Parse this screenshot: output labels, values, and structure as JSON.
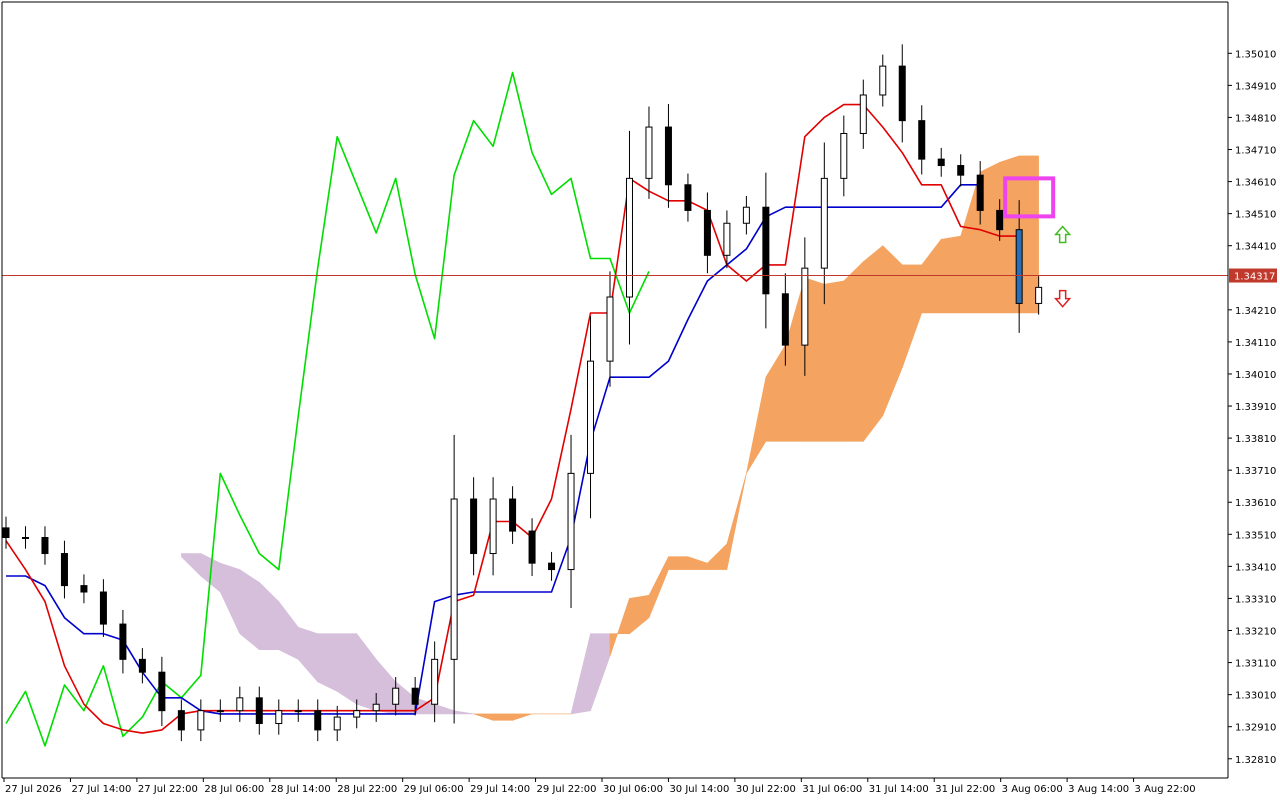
{
  "chart_data": {
    "type": "candlestick",
    "indicator": "Ichimoku Kinko Hyo",
    "ylim": [
      1.3275,
      1.3517
    ],
    "y_ticks": [
      "1.35010",
      "1.34910",
      "1.34810",
      "1.34710",
      "1.34610",
      "1.34510",
      "1.34410",
      "1.34210",
      "1.34110",
      "1.34010",
      "1.33910",
      "1.33810",
      "1.33710",
      "1.33610",
      "1.33510",
      "1.33410",
      "1.33310",
      "1.33210",
      "1.33110",
      "1.33010",
      "1.32910",
      "1.32810"
    ],
    "x_ticks": [
      "27 Jul 2026",
      "27 Jul 14:00",
      "27 Jul 22:00",
      "28 Jul 06:00",
      "28 Jul 14:00",
      "28 Jul 22:00",
      "29 Jul 06:00",
      "29 Jul 14:00",
      "29 Jul 22:00",
      "30 Jul 06:00",
      "30 Jul 14:00",
      "30 Jul 22:00",
      "31 Jul 06:00",
      "31 Jul 14:00",
      "31 Jul 22:00",
      "3 Aug 06:00",
      "3 Aug 14:00",
      "3 Aug 22:00"
    ],
    "current_price": 1.34317,
    "current_price_label": "1.34317",
    "colors": {
      "bull_candle": "#ffffff",
      "bear_candle": "#000000",
      "last_bear_candle": "#2a6fb5",
      "tenkan": "#e00000",
      "kijun": "#0000cc",
      "chikou": "#00dd00",
      "kumo_bear": "#d5bfda",
      "kumo_bull": "#f4a460",
      "price_line": "#c0392b",
      "highlight_box": "#ee44ee",
      "arrow_up": "#44bb22",
      "arrow_down": "#dd2222"
    },
    "series": [
      {
        "name": "",
        "role": "close",
        "values": [
          1.335,
          1.335,
          1.3345,
          1.3335,
          1.3333,
          1.3323,
          1.3312,
          1.3308,
          1.3296,
          1.329,
          1.3296,
          1.3296,
          1.33,
          1.3292,
          1.3296,
          1.3296,
          1.329,
          1.3294,
          1.3296,
          1.3298,
          1.3303,
          1.3298,
          1.3312,
          1.3362,
          1.3345,
          1.3362,
          1.3352,
          1.3342,
          1.334,
          1.337,
          1.3405,
          1.3425,
          1.3462,
          1.3478,
          1.346,
          1.3452,
          1.3438,
          1.3448,
          1.3453,
          1.3426,
          1.341,
          1.3434,
          1.3462,
          1.3476,
          1.3488,
          1.3497,
          1.348,
          1.3468,
          1.3466,
          1.3463,
          1.3452,
          1.3446,
          1.3423,
          1.3428
        ]
      },
      {
        "name": "",
        "role": "tenkan",
        "values": [
          1.3349,
          1.334,
          1.333,
          1.331,
          1.3298,
          1.3292,
          1.329,
          1.3289,
          1.329,
          1.3295,
          1.3296,
          1.3296,
          1.3296,
          1.3296,
          1.3296,
          1.3296,
          1.3296,
          1.3296,
          1.3296,
          1.3296,
          1.3296,
          1.3296,
          1.33,
          1.333,
          1.3332,
          1.3355,
          1.3355,
          1.335,
          1.3362,
          1.339,
          1.342,
          1.342,
          1.3462,
          1.3458,
          1.3455,
          1.3455,
          1.3452,
          1.3435,
          1.343,
          1.3435,
          1.3435,
          1.3475,
          1.3481,
          1.3485,
          1.3485,
          1.3478,
          1.347,
          1.346,
          1.346,
          1.3447,
          1.3446,
          1.3444,
          1.3444
        ]
      },
      {
        "name": "",
        "role": "kijun",
        "values": [
          1.3338,
          1.3338,
          1.3335,
          1.3325,
          1.332,
          1.332,
          1.3318,
          1.3308,
          1.33,
          1.33,
          1.3296,
          1.3295,
          1.3295,
          1.3295,
          1.3295,
          1.3295,
          1.3295,
          1.3295,
          1.3295,
          1.3295,
          1.3295,
          1.3295,
          1.333,
          1.3332,
          1.3333,
          1.3333,
          1.3333,
          1.3333,
          1.3333,
          1.335,
          1.338,
          1.34,
          1.34,
          1.34,
          1.3405,
          1.3418,
          1.343,
          1.3435,
          1.344,
          1.345,
          1.3453,
          1.3453,
          1.3453,
          1.3453,
          1.3453,
          1.3453,
          1.3453,
          1.3453,
          1.3453,
          1.346,
          1.346
        ]
      },
      {
        "name": "",
        "role": "chikou",
        "values": [
          1.3292,
          1.3302,
          1.3285,
          1.3304,
          1.3296,
          1.331,
          1.3288,
          1.3294,
          1.3305,
          1.33,
          1.3307,
          1.337,
          1.3357,
          1.3345,
          1.334,
          1.3388,
          1.3434,
          1.3475,
          1.346,
          1.3445,
          1.3462,
          1.3432,
          1.3412,
          1.3463,
          1.348,
          1.3472,
          1.3495,
          1.347,
          1.3457,
          1.3462,
          1.3437,
          1.3437,
          1.342,
          1.3433
        ]
      },
      {
        "name": "",
        "role": "senkou_a",
        "values": [
          1.3344,
          1.3338,
          1.3333,
          1.332,
          1.3315,
          1.3315,
          1.3312,
          1.3305,
          1.3302,
          1.3298,
          1.3296,
          1.3295,
          1.3295,
          1.3295,
          1.3295,
          1.3295,
          1.3295,
          1.3295,
          1.3295,
          1.3295,
          1.3295,
          1.3296,
          1.3313,
          1.3331,
          1.3332,
          1.3344,
          1.3344,
          1.3342,
          1.3348,
          1.337,
          1.34,
          1.341,
          1.3431,
          1.3429,
          1.343,
          1.3436,
          1.3441,
          1.3435,
          1.3435,
          1.3443,
          1.3444,
          1.3464,
          1.3467,
          1.3469,
          1.3469,
          1.3466,
          1.3462,
          1.3457,
          1.3457,
          1.3454
        ]
      },
      {
        "name": "",
        "role": "senkou_b",
        "values": [
          1.3345,
          1.3345,
          1.3342,
          1.334,
          1.3336,
          1.333,
          1.3322,
          1.332,
          1.332,
          1.332,
          1.3312,
          1.3305,
          1.33,
          1.3298,
          1.3296,
          1.3295,
          1.3293,
          1.3293,
          1.3295,
          1.3295,
          1.3295,
          1.332,
          1.332,
          1.332,
          1.3325,
          1.334,
          1.334,
          1.334,
          1.334,
          1.337,
          1.338,
          1.338,
          1.338,
          1.338,
          1.338,
          1.338,
          1.3388,
          1.3403,
          1.342,
          1.342,
          1.342,
          1.342,
          1.342,
          1.342,
          1.342
        ]
      }
    ]
  }
}
